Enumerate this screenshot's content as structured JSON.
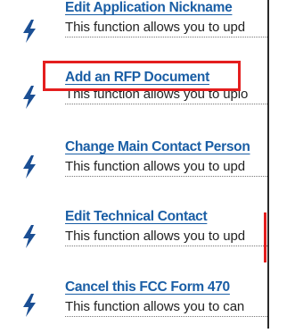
{
  "functions": [
    {
      "title": "Edit Application Nickname",
      "description": "This function allows you to upd",
      "icon": "lightning-bolt-icon"
    },
    {
      "title": "Add an RFP Document",
      "description": "This function allows you to uplo",
      "icon": "lightning-bolt-icon"
    },
    {
      "title": "Change Main Contact Person",
      "description": "This function allows you to upd",
      "icon": "lightning-bolt-icon"
    },
    {
      "title": "Edit Technical Contact",
      "description": "This function allows you to upd",
      "icon": "lightning-bolt-icon"
    },
    {
      "title": "Cancel this FCC Form 470",
      "description": "This function allows you to can",
      "icon": "lightning-bolt-icon"
    }
  ],
  "highlighted_item": "Add an RFP Document",
  "colors": {
    "link": "#1a5ea5",
    "icon": "#1b4f94",
    "highlight": "#e41e1e"
  }
}
